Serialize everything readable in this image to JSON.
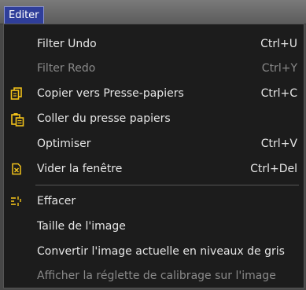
{
  "menu": {
    "title": "Editer"
  },
  "items": [
    {
      "label": "Filter Undo",
      "shortcut": "Ctrl+U",
      "disabled": false,
      "icon": ""
    },
    {
      "label": "Filter Redo",
      "shortcut": "Ctrl+Y",
      "disabled": true,
      "icon": ""
    },
    {
      "label": "Copier vers Presse-papiers",
      "shortcut": "Ctrl+C",
      "disabled": false,
      "icon": "copy-icon"
    },
    {
      "label": "Coller du presse papiers",
      "shortcut": "",
      "disabled": false,
      "icon": "paste-icon"
    },
    {
      "label": "Optimiser",
      "shortcut": "Ctrl+V",
      "disabled": false,
      "icon": ""
    },
    {
      "label": "Vider la fenêtre",
      "shortcut": "Ctrl+Del",
      "disabled": false,
      "icon": "clear-window-icon"
    },
    {
      "label": "Effacer",
      "shortcut": "",
      "disabled": false,
      "icon": "erase-icon"
    },
    {
      "label": "Taille de l'image",
      "shortcut": "",
      "disabled": false,
      "icon": ""
    },
    {
      "label": "Convertir l'image actuelle en niveaux de gris",
      "shortcut": "",
      "disabled": false,
      "icon": ""
    },
    {
      "label": "Afficher la réglette de calibrage sur l'image",
      "shortcut": "",
      "disabled": true,
      "icon": ""
    }
  ],
  "colors": {
    "menu_background": "#1c1c1c",
    "menubar": "#5c5c5c",
    "active_title": "#2f3e9a",
    "text": "#e6e6e6",
    "disabled_text": "#8a8a8a",
    "icon_yellow": "#f2c21a"
  }
}
